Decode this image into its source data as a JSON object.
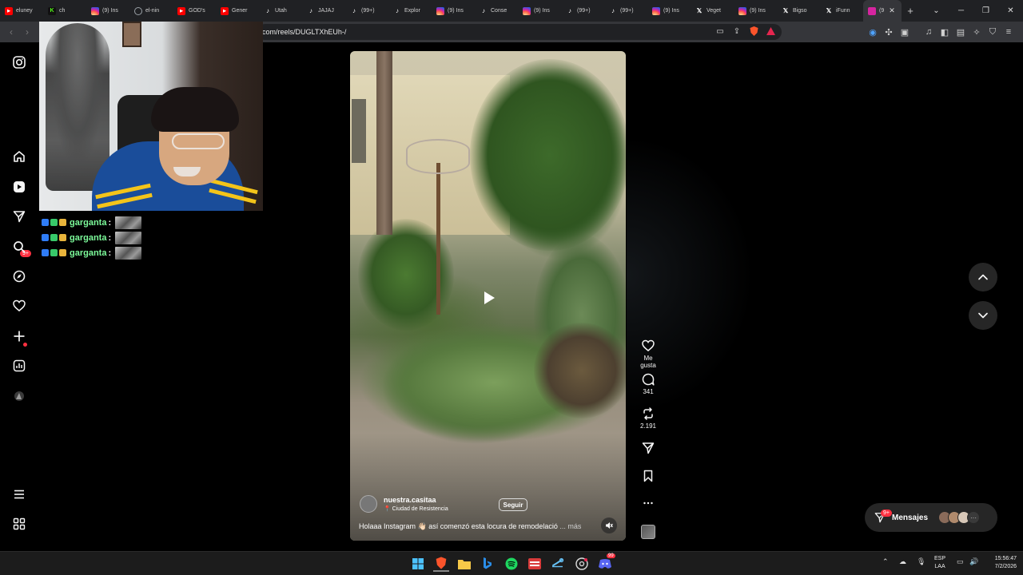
{
  "browser": {
    "tabs": [
      {
        "label": "eluney",
        "icon": "youtube-icon",
        "color": "#ff0000"
      },
      {
        "label": "ch",
        "icon": "kick-icon",
        "color": "#53fc18"
      },
      {
        "label": "(9) Ins",
        "icon": "instagram-icon",
        "color": "#d6249f"
      },
      {
        "label": "el-nin",
        "icon": "globe-icon",
        "color": "#9aa0a6"
      },
      {
        "label": "GOD's",
        "icon": "youtube-icon",
        "color": "#ff0000"
      },
      {
        "label": "Gener",
        "icon": "youtube-icon",
        "color": "#ff0000"
      },
      {
        "label": "Utah",
        "icon": "tiktok-icon",
        "color": "#ffffff"
      },
      {
        "label": "JAJAJ",
        "icon": "tiktok-icon",
        "color": "#ffffff"
      },
      {
        "label": "(99+)",
        "icon": "tiktok-icon",
        "color": "#ffffff"
      },
      {
        "label": "Explor",
        "icon": "tiktok-icon",
        "color": "#ffffff"
      },
      {
        "label": "(9) Ins",
        "icon": "instagram-icon",
        "color": "#d6249f"
      },
      {
        "label": "Conse",
        "icon": "tiktok-icon",
        "color": "#ffffff"
      },
      {
        "label": "(9) Ins",
        "icon": "instagram-icon",
        "color": "#d6249f"
      },
      {
        "label": "(99+)",
        "icon": "tiktok-icon",
        "color": "#ffffff"
      },
      {
        "label": "(99+)",
        "icon": "tiktok-icon",
        "color": "#ffffff"
      },
      {
        "label": "(9) Ins",
        "icon": "instagram-icon",
        "color": "#d6249f"
      },
      {
        "label": "Veget",
        "icon": "x-icon",
        "color": "#ffffff"
      },
      {
        "label": "(9) Ins",
        "icon": "instagram-icon",
        "color": "#d6249f"
      },
      {
        "label": "Bigso",
        "icon": "x-icon",
        "color": "#ffffff"
      },
      {
        "label": "iFunn",
        "icon": "x-icon",
        "color": "#ffffff"
      }
    ],
    "active_tab": {
      "label": "(9",
      "icon": "instagram-icon",
      "color": "#d6249f"
    },
    "new_tab": "+",
    "url": "com/reels/DUGLTXhEUh-/"
  },
  "stream_overlay": {
    "chat": [
      {
        "user": "garganta",
        "sep": ":"
      },
      {
        "user": "garganta",
        "sep": ":"
      },
      {
        "user": "garganta",
        "sep": ":"
      }
    ]
  },
  "sidebar": {
    "notifications_badge": "9+"
  },
  "reel": {
    "author": "nuestra.casitaa",
    "location": "Ciudad de Resistencia",
    "follow_label": "Seguir",
    "caption": "Holaaa Instagram 👋🏻 así comenzó esta locura de remodelació",
    "more_label": "... más",
    "actions": {
      "like_label": "Me gusta",
      "comments_count": "341",
      "reposts_count": "2.191"
    }
  },
  "messages": {
    "label": "Mensajes",
    "badge": "9+"
  },
  "taskbar": {
    "lang_top": "ESP",
    "lang_bottom": "LAA",
    "time": "15:56:47",
    "date": "7/2/2026",
    "discord_badge": "99"
  },
  "colors": {
    "accent": "#ff3040",
    "chat_name": "#7dfc9b",
    "background": "#000000"
  }
}
